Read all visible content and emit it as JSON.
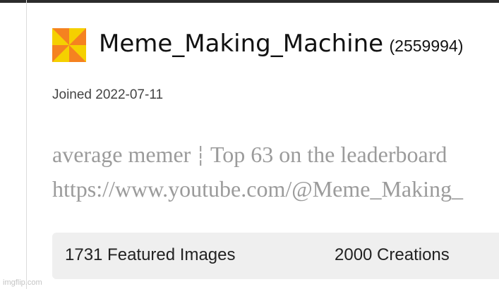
{
  "profile": {
    "username": "Meme_Making_Machine",
    "points": "(2559994)",
    "joined": "Joined 2022-07-11",
    "avatar_icon": "pinwheel-avatar-icon",
    "avatar_colors": [
      "#f58220",
      "#f5d000"
    ]
  },
  "bio": {
    "line1": "average memer",
    "separator": "┆",
    "line1_rest": "Top 63 on the leaderboard",
    "line2": "https://www.youtube.com/@Meme_Making_"
  },
  "stats": {
    "featured": "1731 Featured Images",
    "creations": "2000 Creations"
  },
  "watermark": "imgflip.com",
  "colors": {
    "top_bar": "#2b2b2b",
    "bio_text": "#9b9b9b",
    "stats_bg": "#efefef"
  }
}
